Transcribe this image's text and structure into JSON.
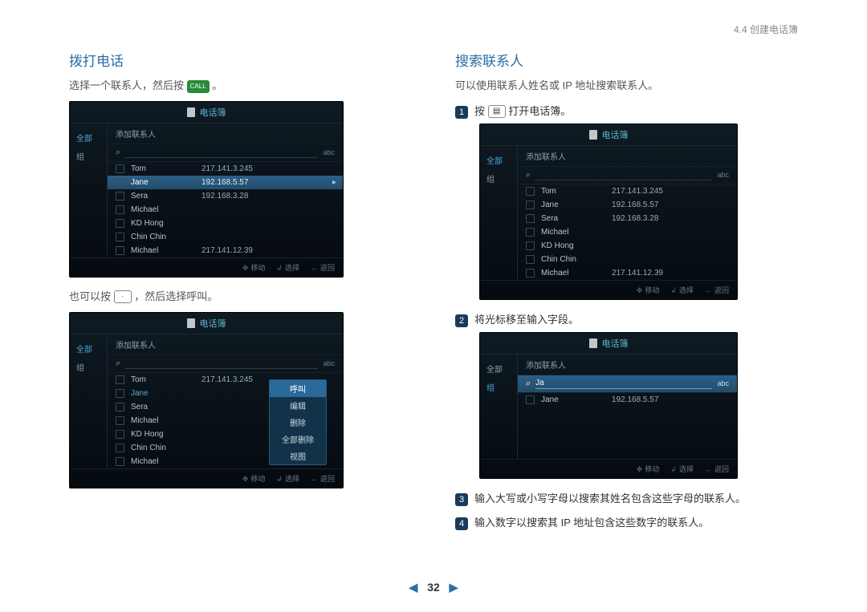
{
  "breadcrumb": "4.4 创建电话簿",
  "page_number": "32",
  "left": {
    "heading": "拨打电话",
    "para1_a": "选择一个联系人，然后按",
    "para1_b": "。",
    "para2_a": "也可以按",
    "para2_b": "，然后选择呼叫。"
  },
  "right": {
    "heading": "搜索联系人",
    "para1": "可以使用联系人姓名或 IP 地址搜索联系人。",
    "step1_a": "按",
    "step1_b": "打开电话簿。",
    "step2": "将光标移至输入字段。",
    "step3": "输入大写或小写字母以搜索其姓名包含这些字母的联系人。",
    "step4": "输入数字以搜索其 IP 地址包含这些数字的联系人。"
  },
  "panel_labels": {
    "title": "电话簿",
    "side_all": "全部",
    "side_group": "组",
    "add_contact": "添加联系人",
    "abc": "abc",
    "foot_move": "移动",
    "foot_select": "选择",
    "foot_back": "返回"
  },
  "contacts_full": [
    {
      "name": "Tom",
      "ip": "217.141.3.245"
    },
    {
      "name": "Jane",
      "ip": "192.168.5.57"
    },
    {
      "name": "Sera",
      "ip": "192.168.3.28"
    },
    {
      "name": "Michael",
      "ip": ""
    },
    {
      "name": "KD Hong",
      "ip": ""
    },
    {
      "name": "Chin Chin",
      "ip": ""
    },
    {
      "name": "Michael",
      "ip": "217.141.12.39"
    }
  ],
  "ctx_menu": {
    "call": "呼叫",
    "edit": "编辑",
    "delete": "删除",
    "delete_all": "全部删除",
    "view": "视图"
  },
  "search_sample": {
    "query": "Ja",
    "results": [
      {
        "name": "Jane",
        "ip": "192.168.5.57"
      }
    ]
  }
}
